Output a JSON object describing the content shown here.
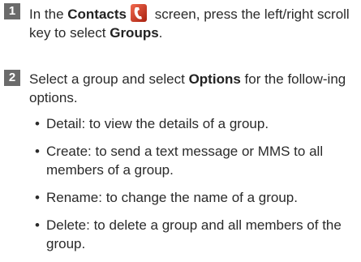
{
  "steps": [
    {
      "number": "1",
      "text_before": "In the ",
      "bold_1": "Contacts",
      "icon": "contacts-phone-icon",
      "text_middle": " screen, press the left/right scroll key to select ",
      "bold_2": "Groups",
      "text_after": "."
    },
    {
      "number": "2",
      "text_before": "Select a group and select ",
      "bold_1": "Options",
      "text_after": " for the follow-ing options.",
      "bullets": [
        "Detail: to view the details of a group.",
        "Create: to send a text message or MMS to all members of a group.",
        "Rename: to change the name of a group.",
        "Delete: to delete a group and all members of the group."
      ]
    }
  ],
  "colors": {
    "badge": "#6b6b6b",
    "icon_bg": "#c8321e"
  }
}
